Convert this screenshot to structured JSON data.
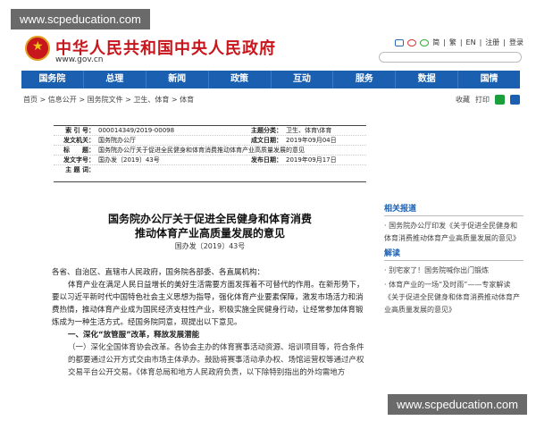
{
  "watermark": {
    "text": "www.scpeducation.com"
  },
  "header": {
    "title": "中华人民共和国中央人民政府",
    "url": "www.gov.cn",
    "links": [
      "简",
      "繁",
      "EN",
      "注册",
      "登录"
    ]
  },
  "nav": {
    "items": [
      "国务院",
      "总理",
      "新闻",
      "政策",
      "互动",
      "服务",
      "数据",
      "国情"
    ]
  },
  "breadcrumb": {
    "path": "首页 > 信息公开 > 国务院文件 > 卫生、体育 > 体育",
    "collect": "收藏",
    "print": "打印"
  },
  "meta": {
    "rows": [
      {
        "k1": "索 引 号：",
        "v1": "000014349/2019-00098",
        "k2": "主题分类：",
        "v2": "卫生、体育\\体育"
      },
      {
        "k1": "发文机关：",
        "v1": "国务院办公厅",
        "k2": "成文日期：",
        "v2": "2019年09月04日"
      },
      {
        "k1": "标　　题：",
        "v1": "国务院办公厅关于促进全民健身和体育消费推动体育产业高质量发展的意见",
        "k2": "",
        "v2": ""
      },
      {
        "k1": "发文字号：",
        "v1": "国办发〔2019〕43号",
        "k2": "发布日期：",
        "v2": "2019年09月17日"
      },
      {
        "k1": "主 题 词：",
        "v1": "",
        "k2": "",
        "v2": ""
      }
    ]
  },
  "doc": {
    "title_line1": "国务院办公厅关于促进全民健身和体育消费",
    "title_line2": "推动体育产业高质量发展的意见",
    "number": "国办发〔2019〕43号",
    "greeting": "各省、自治区、直辖市人民政府，国务院各部委、各直属机构：",
    "para1": "体育产业在满足人民日益增长的美好生活需要方面发挥着不可替代的作用。在新形势下，要以习近平新时代中国特色社会主义思想为指导，强化体育产业要素保障，激发市场活力和消费热情，推动体育产业成为国民经济支柱性产业，积极实施全民健身行动，让经常参加体育锻炼成为一种生活方式。经国务院同意，现提出以下意见。",
    "section1": "一、深化“放管服”改革，释放发展潜能",
    "sub1": "（一）深化全国体育协会改革。各协会主办的体育赛事活动资源、培训项目等，符合条件的都要通过公开方式交由市场主体承办。鼓励将赛事活动承办权、场馆运营权等通过产权交易平台公开交易。《体育总局和地方人民政府负责，以下除特别指出的外均需地方"
  },
  "sidebar": {
    "related_title": "相关报道",
    "related": [
      "国务院办公厅印发《关于促进全民健身和体育消费推动体育产业高质量发展的意见》"
    ],
    "interp_title": "解读",
    "interps": [
      "别宅家了！国务院喊你出门锻炼",
      "体育产业的一场“及时雨”——专家解读《关于促进全民健身和体育消费推动体育产业高质量发展的意见》"
    ]
  }
}
